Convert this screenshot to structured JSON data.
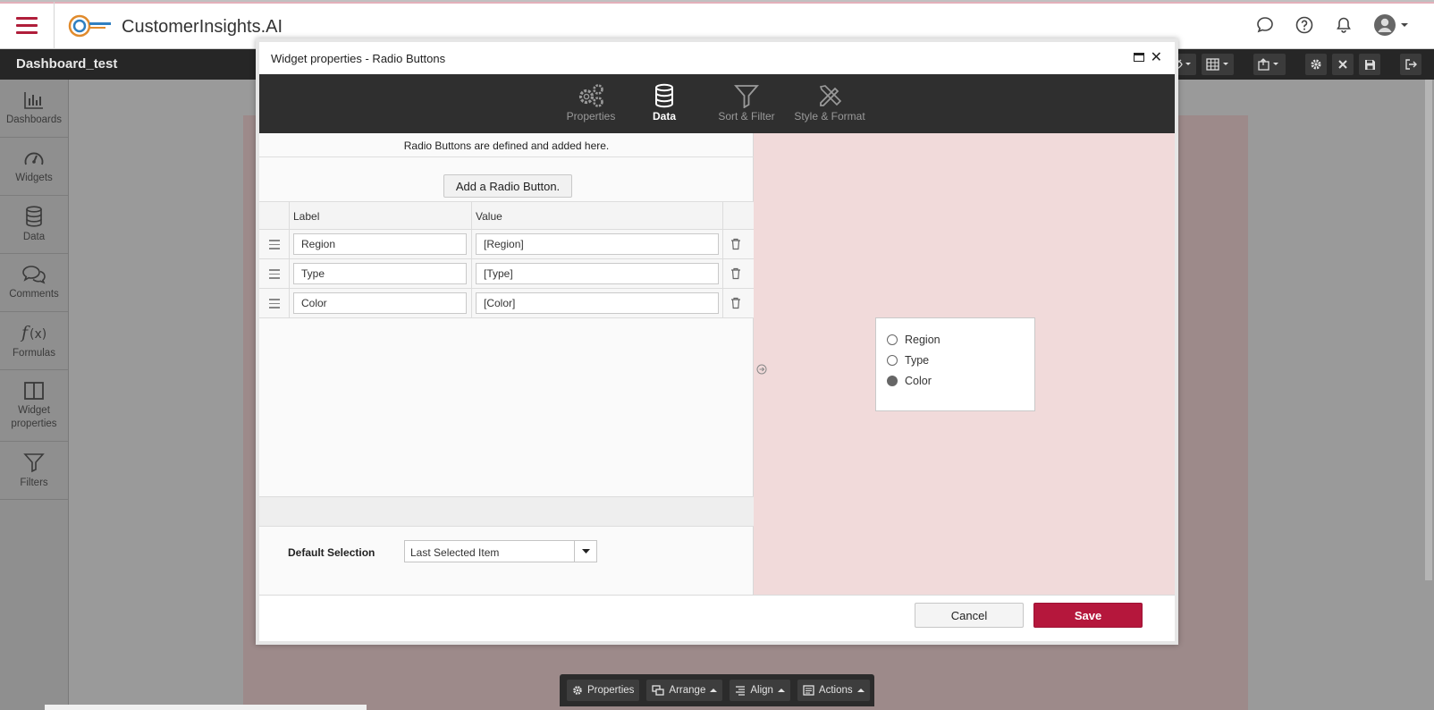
{
  "app": {
    "title": "CustomerInsights.AI",
    "logo_text": "customer insights",
    "dashboard_name": "Dashboard_test",
    "accent_color": "#b5173c"
  },
  "topbar": {
    "icons": [
      "chat-icon",
      "help-icon",
      "bell-icon",
      "user-avatar-icon"
    ]
  },
  "leftnav": {
    "items": [
      {
        "label": "Dashboards",
        "icon": "bar-chart-icon"
      },
      {
        "label": "Widgets",
        "icon": "gauge-icon"
      },
      {
        "label": "Data",
        "icon": "database-icon"
      },
      {
        "label": "Comments",
        "icon": "comments-icon"
      },
      {
        "label": "Formulas",
        "icon": "function-icon"
      },
      {
        "label": "Widget properties",
        "icon": "panel-icon"
      },
      {
        "label": "Filters",
        "icon": "filter-icon"
      }
    ]
  },
  "modal": {
    "title": "Widget properties - Radio Buttons",
    "tabs": [
      {
        "label": "Properties",
        "icon": "gears-icon",
        "active": false
      },
      {
        "label": "Data",
        "icon": "database-icon",
        "active": true
      },
      {
        "label": "Sort & Filter",
        "icon": "funnel-icon",
        "active": false
      },
      {
        "label": "Style & Format",
        "icon": "pencil-ruler-icon",
        "active": false
      }
    ],
    "caption": "Radio Buttons are defined and added here.",
    "add_button": "Add a Radio Button.",
    "columns": {
      "label": "Label",
      "value": "Value"
    },
    "rows": [
      {
        "label": "Region",
        "value": "[Region]"
      },
      {
        "label": "Type",
        "value": "[Type]"
      },
      {
        "label": "Color",
        "value": "[Color]"
      }
    ],
    "default_selection_label": "Default Selection",
    "default_selection_value": "Last Selected Item",
    "preview_options": [
      {
        "label": "Region",
        "selected": false
      },
      {
        "label": "Type",
        "selected": false
      },
      {
        "label": "Color",
        "selected": true
      }
    ],
    "cancel": "Cancel",
    "save": "Save"
  },
  "bottombar": {
    "properties": "Properties",
    "arrange": "Arrange",
    "align": "Align",
    "actions": "Actions"
  }
}
